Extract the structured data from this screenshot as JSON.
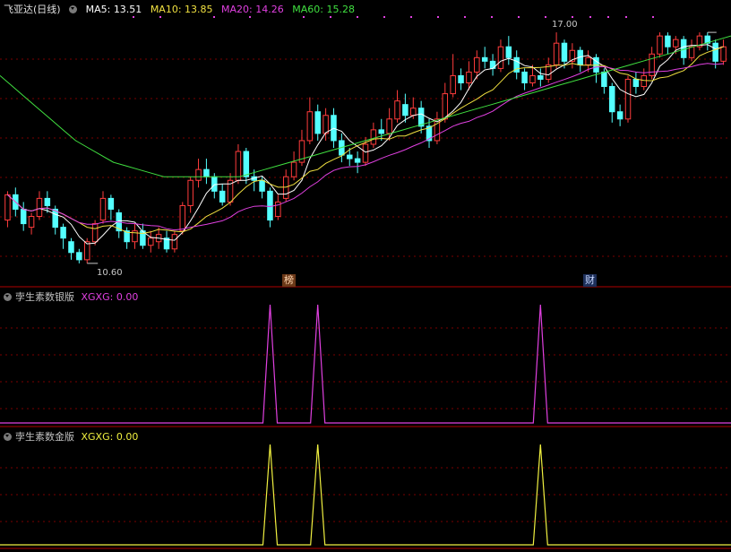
{
  "stock": {
    "title": "飞亚达(日线)"
  },
  "ma_legend": {
    "ma5": {
      "label": "MA5: ",
      "value": "13.51",
      "color": "#ffffff"
    },
    "ma10": {
      "label": "MA10: ",
      "value": "13.85",
      "color": "#f0e040"
    },
    "ma20": {
      "label": "MA20: ",
      "value": "14.26",
      "color": "#e040e0"
    },
    "ma60": {
      "label": "MA60: ",
      "value": "15.28",
      "color": "#40e040"
    }
  },
  "annotations": {
    "high": "17.00",
    "low": "10.60"
  },
  "badges": {
    "bang": "榜",
    "cai": "财"
  },
  "panels": [
    {
      "name": "孛生素数银版",
      "indicator": "XGXG: ",
      "value": "0.00",
      "color": "#e040e0"
    },
    {
      "name": "孛生素数金版",
      "indicator": "XGXG: ",
      "value": "0.00",
      "color": "#f0f040"
    }
  ],
  "colors": {
    "up": "#ff3c3c",
    "down": "#54ffff",
    "grid": "#7a0000",
    "divider": "#b00000"
  },
  "chart_data": [
    {
      "type": "candlestick",
      "series_note": "daily OHLC, approximate",
      "candles": [
        [
          11.8,
          12.5,
          12.6,
          11.6
        ],
        [
          12.5,
          12.1,
          12.7,
          11.9
        ],
        [
          12.1,
          11.7,
          12.3,
          11.5
        ],
        [
          11.6,
          11.9,
          12.0,
          11.4
        ],
        [
          11.9,
          12.4,
          12.6,
          11.8
        ],
        [
          12.4,
          12.2,
          12.6,
          12.0
        ],
        [
          12.1,
          11.6,
          12.2,
          11.4
        ],
        [
          11.6,
          11.3,
          11.7,
          11.0
        ],
        [
          11.2,
          10.9,
          11.3,
          10.7
        ],
        [
          10.9,
          10.7,
          11.0,
          10.6
        ],
        [
          10.7,
          11.2,
          11.3,
          10.6
        ],
        [
          11.2,
          11.7,
          11.8,
          11.1
        ],
        [
          11.8,
          12.4,
          12.6,
          11.7
        ],
        [
          12.4,
          12.1,
          12.5,
          11.8
        ],
        [
          12.0,
          11.5,
          12.1,
          11.3
        ],
        [
          11.5,
          11.2,
          11.6,
          11.0
        ],
        [
          11.2,
          11.5,
          11.7,
          11.0
        ],
        [
          11.5,
          11.1,
          11.7,
          11.0
        ],
        [
          11.1,
          11.3,
          11.5,
          10.9
        ],
        [
          11.2,
          11.4,
          11.6,
          11.0
        ],
        [
          11.3,
          11.0,
          11.5,
          10.9
        ],
        [
          11.0,
          11.4,
          11.5,
          10.9
        ],
        [
          11.5,
          12.2,
          12.3,
          11.4
        ],
        [
          12.2,
          12.9,
          13.0,
          12.0
        ],
        [
          12.9,
          13.2,
          13.5,
          12.7
        ],
        [
          13.2,
          13.0,
          13.5,
          12.8
        ],
        [
          13.0,
          12.6,
          13.1,
          12.4
        ],
        [
          12.6,
          12.3,
          12.8,
          12.2
        ],
        [
          12.3,
          12.9,
          13.1,
          12.2
        ],
        [
          12.9,
          13.7,
          13.9,
          12.8
        ],
        [
          13.7,
          13.0,
          13.8,
          12.8
        ],
        [
          13.0,
          12.9,
          13.2,
          12.6
        ],
        [
          12.9,
          12.6,
          13.0,
          12.4
        ],
        [
          12.6,
          11.8,
          12.7,
          11.6
        ],
        [
          11.9,
          12.3,
          12.5,
          11.8
        ],
        [
          12.4,
          13.0,
          13.2,
          12.3
        ],
        [
          13.0,
          13.4,
          13.7,
          12.9
        ],
        [
          13.4,
          14.0,
          14.3,
          13.3
        ],
        [
          14.0,
          14.8,
          15.2,
          13.9
        ],
        [
          14.8,
          14.2,
          15.0,
          14.0
        ],
        [
          14.2,
          14.7,
          14.9,
          14.0
        ],
        [
          14.7,
          14.0,
          14.9,
          13.8
        ],
        [
          14.0,
          13.6,
          14.2,
          13.4
        ],
        [
          13.6,
          13.5,
          13.8,
          13.3
        ],
        [
          13.5,
          13.4,
          13.7,
          13.1
        ],
        [
          13.4,
          13.9,
          14.1,
          13.3
        ],
        [
          13.9,
          14.3,
          14.5,
          13.8
        ],
        [
          14.3,
          14.2,
          14.6,
          14.0
        ],
        [
          14.2,
          14.6,
          14.9,
          14.0
        ],
        [
          14.6,
          15.1,
          15.4,
          14.5
        ],
        [
          15.0,
          14.7,
          15.3,
          14.5
        ],
        [
          14.7,
          14.9,
          15.2,
          14.6
        ],
        [
          14.9,
          14.4,
          15.1,
          14.2
        ],
        [
          14.4,
          14.0,
          14.6,
          13.8
        ],
        [
          14.0,
          14.6,
          14.8,
          13.9
        ],
        [
          14.6,
          15.3,
          15.6,
          14.5
        ],
        [
          15.3,
          15.8,
          16.4,
          15.2
        ],
        [
          15.8,
          15.6,
          16.0,
          15.4
        ],
        [
          15.6,
          15.9,
          16.2,
          15.4
        ],
        [
          15.9,
          16.3,
          16.5,
          15.7
        ],
        [
          16.3,
          16.2,
          16.6,
          16.0
        ],
        [
          16.2,
          16.0,
          16.4,
          15.8
        ],
        [
          16.0,
          16.6,
          16.8,
          15.9
        ],
        [
          16.6,
          16.3,
          16.9,
          16.1
        ],
        [
          16.3,
          15.9,
          16.5,
          15.7
        ],
        [
          15.9,
          15.6,
          16.0,
          15.4
        ],
        [
          15.6,
          15.8,
          16.1,
          15.5
        ],
        [
          15.8,
          15.7,
          16.0,
          15.5
        ],
        [
          15.7,
          16.1,
          16.3,
          15.6
        ],
        [
          16.1,
          16.7,
          17.0,
          16.0
        ],
        [
          16.7,
          16.2,
          16.8,
          16.0
        ],
        [
          16.2,
          16.5,
          16.7,
          16.0
        ],
        [
          16.5,
          16.1,
          16.6,
          15.9
        ],
        [
          16.1,
          16.3,
          16.5,
          15.9
        ],
        [
          16.3,
          15.9,
          16.4,
          15.6
        ],
        [
          15.9,
          15.5,
          16.0,
          15.3
        ],
        [
          15.5,
          14.8,
          15.6,
          14.5
        ],
        [
          14.8,
          14.6,
          15.0,
          14.4
        ],
        [
          14.6,
          15.7,
          15.8,
          14.5
        ],
        [
          15.7,
          15.5,
          15.9,
          15.3
        ],
        [
          15.5,
          15.8,
          16.0,
          15.4
        ],
        [
          15.8,
          16.4,
          16.6,
          15.7
        ],
        [
          16.4,
          16.9,
          17.0,
          16.3
        ],
        [
          16.9,
          16.6,
          17.0,
          16.4
        ],
        [
          16.6,
          16.8,
          16.9,
          16.4
        ],
        [
          16.8,
          16.3,
          16.9,
          16.1
        ],
        [
          16.3,
          16.6,
          16.8,
          16.2
        ],
        [
          16.6,
          16.9,
          17.0,
          16.5
        ],
        [
          16.9,
          16.7,
          17.0,
          16.5
        ],
        [
          16.7,
          16.2,
          16.8,
          16.0
        ],
        [
          16.2,
          16.6,
          16.8,
          16.1
        ]
      ],
      "ma_lines": {
        "MA60": [
          15.8,
          15.5,
          15.2,
          14.9,
          14.6,
          14.3,
          14.0,
          13.8,
          13.6,
          13.4,
          13.3,
          13.2,
          13.1,
          13.0,
          13.0,
          13.0,
          13.0,
          13.0,
          13.0,
          13.0,
          13.1,
          13.2,
          13.3,
          13.4,
          13.5,
          13.6,
          13.7,
          13.8,
          13.9,
          14.0,
          14.1,
          14.2,
          14.3,
          14.4,
          14.5,
          14.6,
          14.7,
          14.8,
          14.9,
          15.0,
          15.1,
          15.2,
          15.3,
          15.4,
          15.5,
          15.6,
          15.7,
          15.8,
          15.9,
          16.0,
          16.1,
          16.2,
          16.3,
          16.4,
          16.5,
          16.6,
          16.7,
          16.8,
          16.9
        ]
      },
      "extremes": {
        "high": 17.0,
        "low": 10.6
      }
    },
    {
      "type": "line",
      "name": "XGXG",
      "values_note": "spikes of 1 at signal days, 0 elsewhere",
      "spike_indices": [
        33,
        39,
        67
      ],
      "ylim": [
        0,
        1
      ]
    },
    {
      "type": "line",
      "name": "XGXG",
      "spike_indices": [
        33,
        39,
        67
      ],
      "ylim": [
        0,
        1
      ]
    }
  ]
}
